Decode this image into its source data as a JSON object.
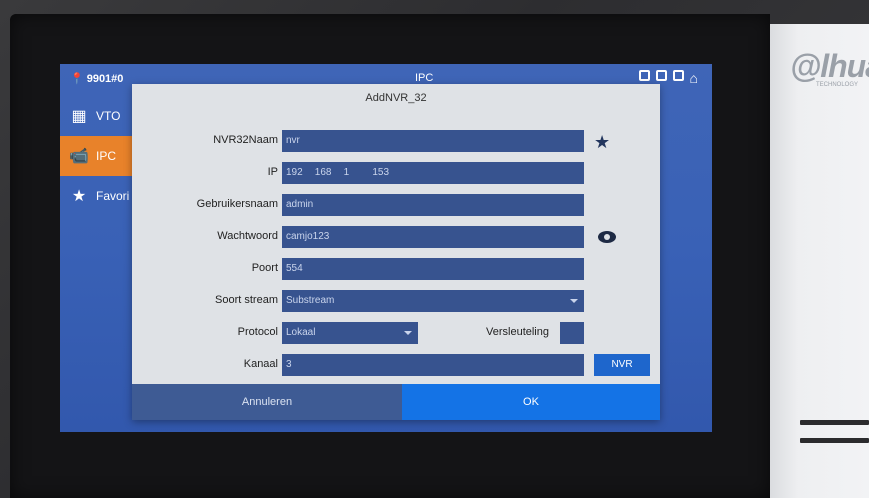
{
  "device": {
    "brand": "@lhua",
    "brand_sub": "TECHNOLOGY"
  },
  "status": {
    "location": "9901#0",
    "title": "IPC"
  },
  "nav": {
    "items": [
      {
        "label": "VTO"
      },
      {
        "label": "IPC"
      },
      {
        "label": "Favori"
      }
    ]
  },
  "dialog": {
    "title": "AddNVR_32",
    "fields": {
      "name": {
        "label": "NVR32Naam",
        "value": "nvr"
      },
      "ip": {
        "label": "IP",
        "segments": [
          "192",
          "168",
          "1",
          "153"
        ]
      },
      "username": {
        "label": "Gebruikersnaam",
        "value": "admin"
      },
      "password": {
        "label": "Wachtwoord",
        "value": "camjo123"
      },
      "port": {
        "label": "Poort",
        "value": "554"
      },
      "stream": {
        "label": "Soort stream",
        "value": "Substream"
      },
      "protocol": {
        "label": "Protocol",
        "value": "Lokaal"
      },
      "encryption": {
        "label": "Versleuteling"
      },
      "channel": {
        "label": "Kanaal",
        "value": "3"
      }
    },
    "nvr_button": "NVR",
    "cancel_label": "Annuleren",
    "ok_label": "OK"
  },
  "colors": {
    "accent": "#e8822a",
    "primary": "#1473e6",
    "field": "#37538f"
  }
}
